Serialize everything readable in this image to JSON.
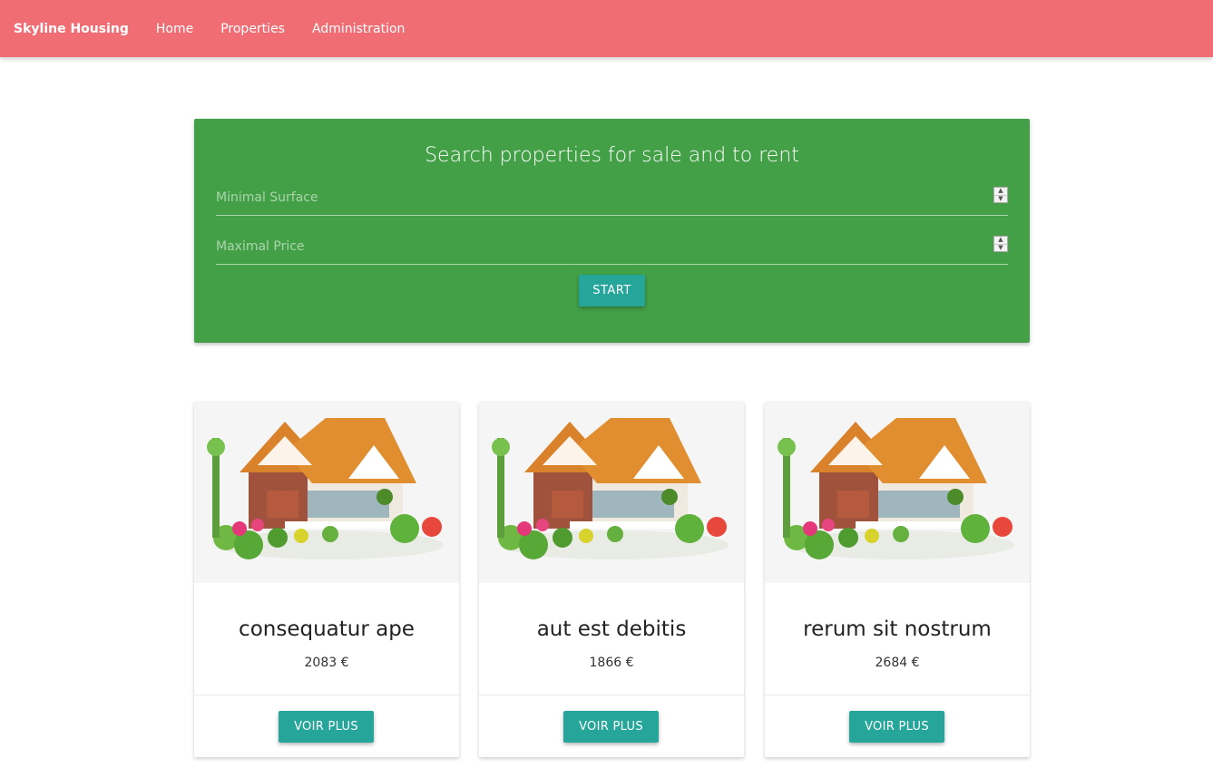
{
  "navbar": {
    "brand": "Skyline Housing",
    "links": [
      "Home",
      "Properties",
      "Administration"
    ]
  },
  "search": {
    "title": "Search properties for sale and to rent",
    "min_surface_placeholder": "Minimal Surface",
    "max_price_placeholder": "Maximal Price",
    "start_label": "START"
  },
  "properties": [
    {
      "title": "consequatur ape",
      "price": "2083 €",
      "action_label": "VOIR PLUS",
      "image_icon": "house-image"
    },
    {
      "title": "aut est debitis",
      "price": "1866 €",
      "action_label": "VOIR PLUS",
      "image_icon": "house-image"
    },
    {
      "title": "rerum sit nostrum",
      "price": "2684 €",
      "action_label": "VOIR PLUS",
      "image_icon": "house-image"
    }
  ],
  "colors": {
    "navbar": "#f06d74",
    "search_panel": "#43a047",
    "button": "#26a69a"
  }
}
